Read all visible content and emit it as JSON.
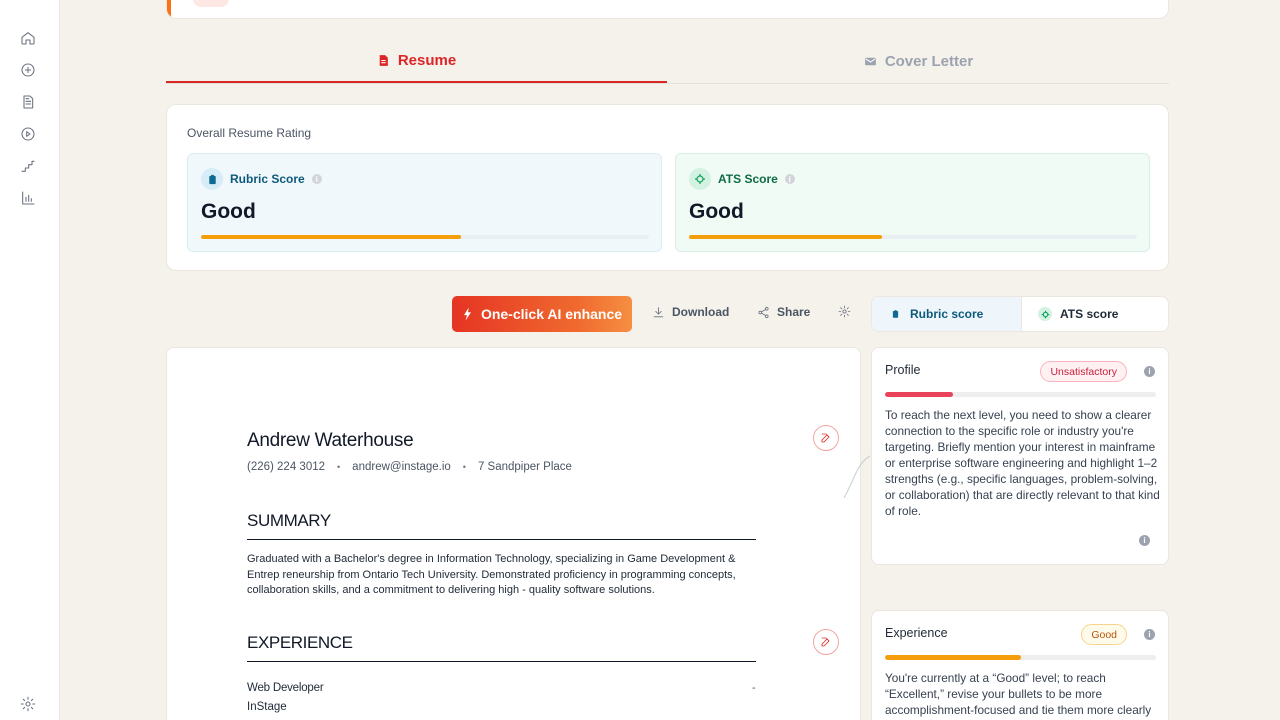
{
  "sidebar": {
    "items": [
      {
        "icon": "home-icon"
      },
      {
        "icon": "plus-circle-icon"
      },
      {
        "icon": "document-icon"
      },
      {
        "icon": "play-circle-icon"
      },
      {
        "icon": "stairs-icon"
      },
      {
        "icon": "bar-chart-icon"
      }
    ],
    "settings_icon": "gear-icon"
  },
  "tabs": [
    {
      "label": "Resume",
      "icon": "file-icon",
      "active": true
    },
    {
      "label": "Cover Letter",
      "icon": "envelope-icon",
      "active": false
    }
  ],
  "rating": {
    "title": "Overall Resume Rating",
    "rubric": {
      "label": "Rubric Score",
      "value": "Good",
      "progress": 0.58
    },
    "ats": {
      "label": "ATS Score",
      "value": "Good",
      "progress": 0.43
    }
  },
  "toolbar": {
    "enhance_label": "One-click AI enhance",
    "download_label": "Download",
    "share_label": "Share"
  },
  "score_toggle": {
    "rubric_label": "Rubric score",
    "ats_label": "ATS score",
    "selected": "rubric"
  },
  "resume": {
    "name": "Andrew Waterhouse",
    "phone": "(226) 224 3012",
    "email": "andrew@instage.io",
    "address": "7 Sandpiper Place",
    "separator": "•",
    "summary_heading": "SUMMARY",
    "summary_text": "Graduated with a Bachelor's degree in Information Technology, specializing in Game Development & Entrep reneurship from Ontario Tech University. Demonstrated proficiency in programming concepts, collaboration skills, and a commitment to delivering high - quality software solutions.",
    "experience_heading": "EXPERIENCE",
    "job_title": "Web Developer",
    "job_dates": "-",
    "company": "InStage"
  },
  "feedback": [
    {
      "title": "Profile",
      "badge": "Unsatisfactory",
      "badge_color": "#c81e3b",
      "progress": 0.25,
      "bar_color": "#e8435a",
      "text": "To reach the next level, you need to show a clearer connection to the specific role or industry you're targeting. Briefly mention your interest in mainframe or enterprise software engineering and highlight 1–2 strengths (e.g., specific languages, problem-solving, or collaboration) that are directly relevant to that kind of role."
    },
    {
      "title": "Experience",
      "badge": "Good",
      "badge_color": "#b45309",
      "progress": 0.5,
      "bar_color": "#f59e0b",
      "text": "You're currently at a “Good” level; to reach “Excellent,” revise your bullets to be more accomplishment-focused and tie them more clearly"
    }
  ],
  "colors": {
    "accent_red": "#dc2626",
    "progress_amber": "#f59e0b",
    "background": "#f5f2ec"
  }
}
